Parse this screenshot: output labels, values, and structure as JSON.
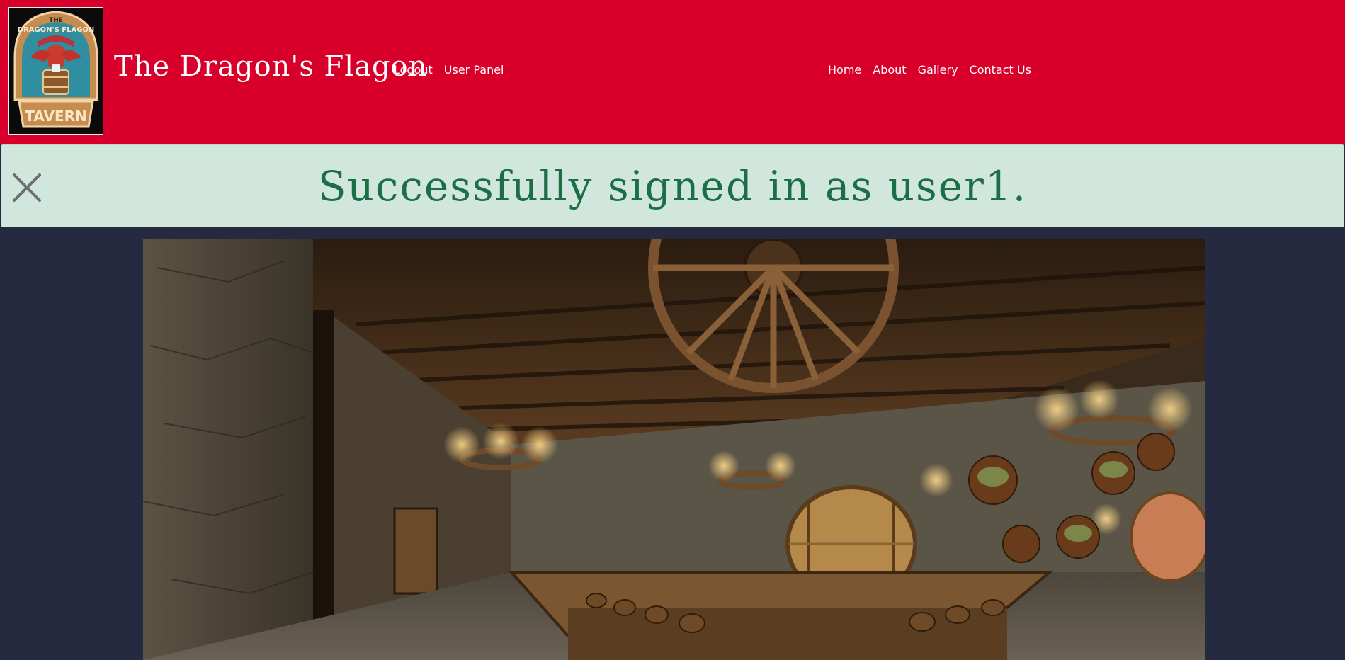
{
  "header": {
    "title": "The Dragon's Flagon",
    "logo": {
      "top_text": "THE",
      "arc_text": "DRAGON'S FLAGON",
      "bottom_text": "TAVERN",
      "icon": "dragon-on-barrel-logo"
    },
    "user_nav": [
      {
        "label": "Logout"
      },
      {
        "label": "User Panel"
      }
    ],
    "main_nav": [
      {
        "label": "Home"
      },
      {
        "label": "About"
      },
      {
        "label": "Gallery"
      },
      {
        "label": "Contact Us"
      }
    ]
  },
  "alert": {
    "message": "Successfully signed in as user1.",
    "close_icon": "close-icon"
  },
  "hero": {
    "description_icon": "tavern-interior-photo"
  },
  "colors": {
    "header_bg": "#d8002a",
    "page_bg": "#262a40",
    "alert_bg": "#d1e7dd",
    "alert_text": "#1b6e45"
  }
}
